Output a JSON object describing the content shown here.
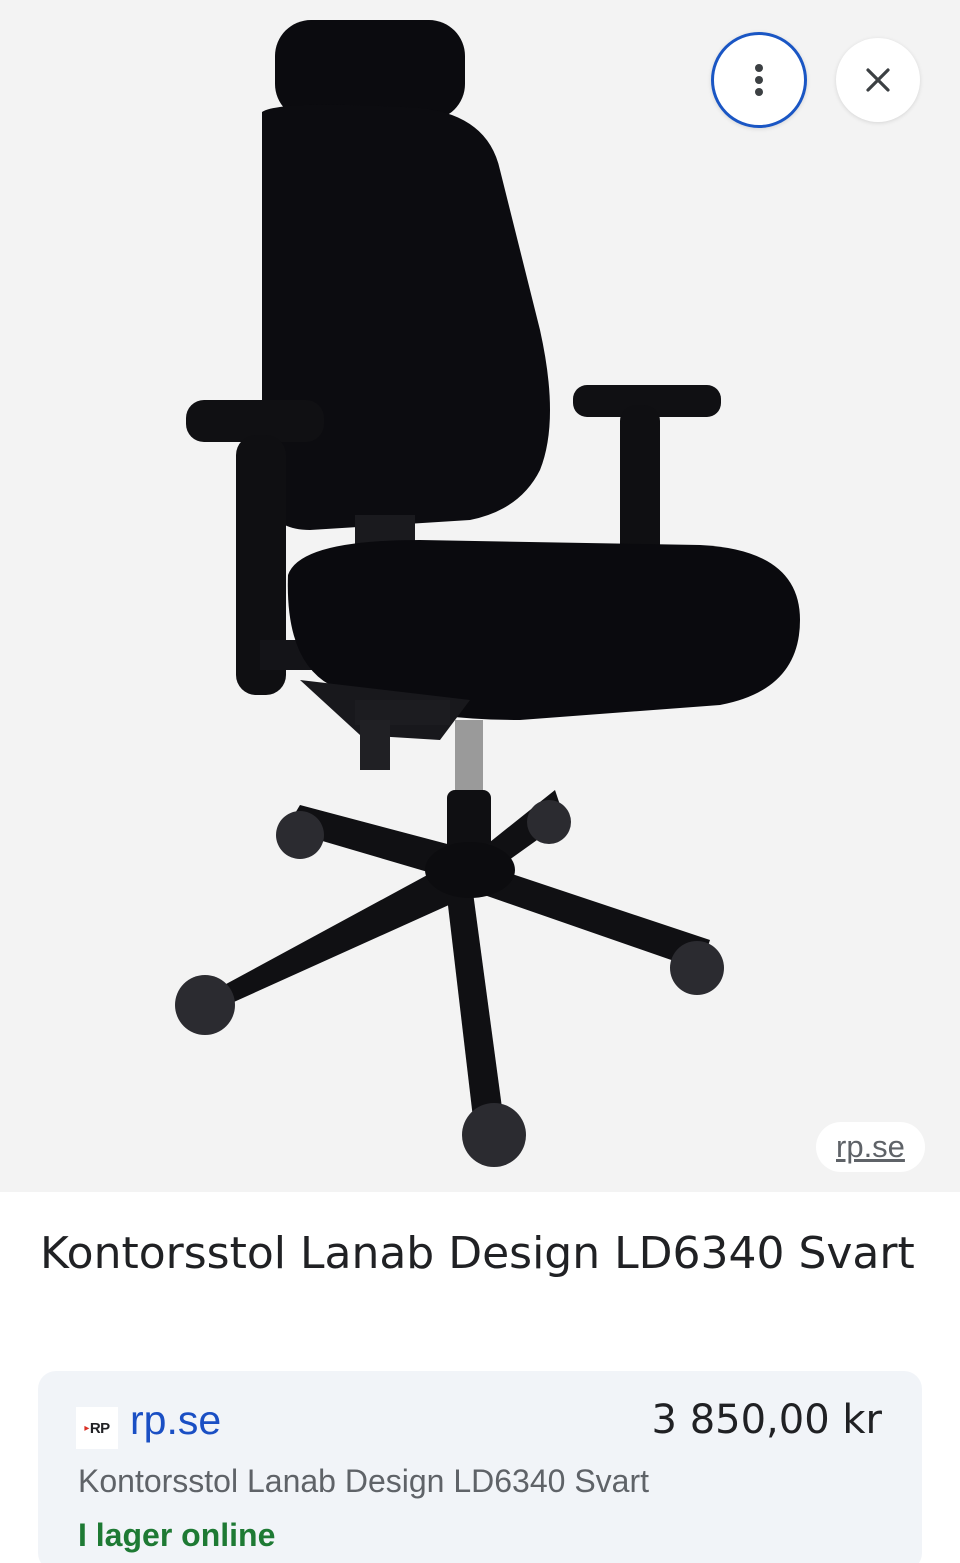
{
  "image": {
    "alt_icon": "office-chair-photo",
    "source_chip": "rp.se"
  },
  "toolbar": {
    "more_icon": "more-vert-icon",
    "close_icon": "close-icon"
  },
  "product": {
    "title": "Kontorsstol Lanab Design LD6340 Svart"
  },
  "offer": {
    "merchant_logo_text": "RP",
    "merchant_name": "rp.se",
    "price": "3 850,00 kr",
    "description": "Kontorsstol Lanab Design LD6340 Svart",
    "stock_status": "I lager online"
  },
  "colors": {
    "focus_ring": "#1a56c4",
    "link": "#1a4fc4",
    "in_stock": "#1e7a34",
    "card_bg": "#f1f4f8"
  }
}
